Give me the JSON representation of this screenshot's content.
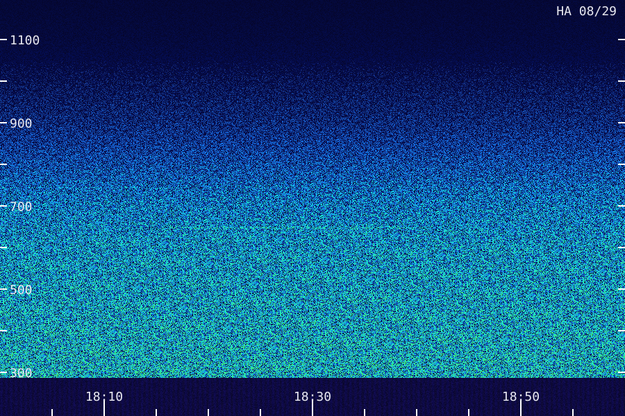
{
  "chart_data": {
    "type": "heatmap",
    "title": "HA 08/29",
    "xlabel": "",
    "ylabel": "",
    "y_axis": {
      "min": 300,
      "max": 1300,
      "ticks": [
        300,
        400,
        500,
        600,
        700,
        800,
        900,
        1000,
        1100,
        1200
      ],
      "labels": [
        {
          "value": 300,
          "text": "300"
        },
        {
          "value": 500,
          "text": "500"
        },
        {
          "value": 700,
          "text": "700"
        },
        {
          "value": 900,
          "text": "900"
        },
        {
          "value": 1100,
          "text": "1100"
        }
      ]
    },
    "x_axis": {
      "start": "18:00",
      "end": "19:00",
      "major_ticks": [
        "18:10",
        "18:30",
        "18:50"
      ],
      "minor_ticks": [
        "18:05",
        "18:15",
        "18:20",
        "18:25",
        "18:35",
        "18:40",
        "18:45",
        "18:55"
      ],
      "labels": [
        "18:10",
        "18:30",
        "18:50"
      ]
    },
    "intensity_profile": [
      {
        "freq": 300,
        "level": 0.9
      },
      {
        "freq": 400,
        "level": 0.85
      },
      {
        "freq": 500,
        "level": 0.8
      },
      {
        "freq": 600,
        "level": 0.75
      },
      {
        "freq": 700,
        "level": 0.65
      },
      {
        "freq": 800,
        "level": 0.5
      },
      {
        "freq": 900,
        "level": 0.35
      },
      {
        "freq": 1000,
        "level": 0.25
      },
      {
        "freq": 1100,
        "level": 0.15
      },
      {
        "freq": 1200,
        "level": 0.1
      }
    ],
    "colors": {
      "low": "#06063a",
      "mid": "#2040f0",
      "high": "#20e0c0",
      "peak": "#40f080",
      "footer": "#0a0a3a"
    }
  }
}
